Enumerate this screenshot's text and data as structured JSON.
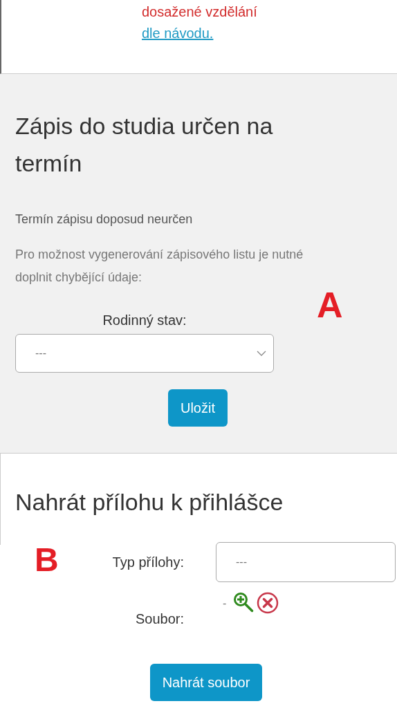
{
  "notice": {
    "text": "dosažené vzdělání",
    "link": "dle návodu."
  },
  "enrollment": {
    "title": "Zápis do studia určen na termín",
    "status": "Termín zápisu doposud neurčen",
    "info": "Pro možnost vygenerování zápisového listu je nutné doplnit chybějící údaje:",
    "field": {
      "label": "Rodinný stav:",
      "value": "---"
    },
    "button": "Uložit",
    "annotation": "A"
  },
  "attachment": {
    "title": "Nahrát přílohu k přihlášce",
    "annotation": "B",
    "fields": [
      {
        "kind": "select",
        "label": "Typ přílohy:",
        "value": "---"
      },
      {
        "kind": "file",
        "label": "Soubor:",
        "value": "-"
      }
    ],
    "button": "Nahrát soubor"
  }
}
